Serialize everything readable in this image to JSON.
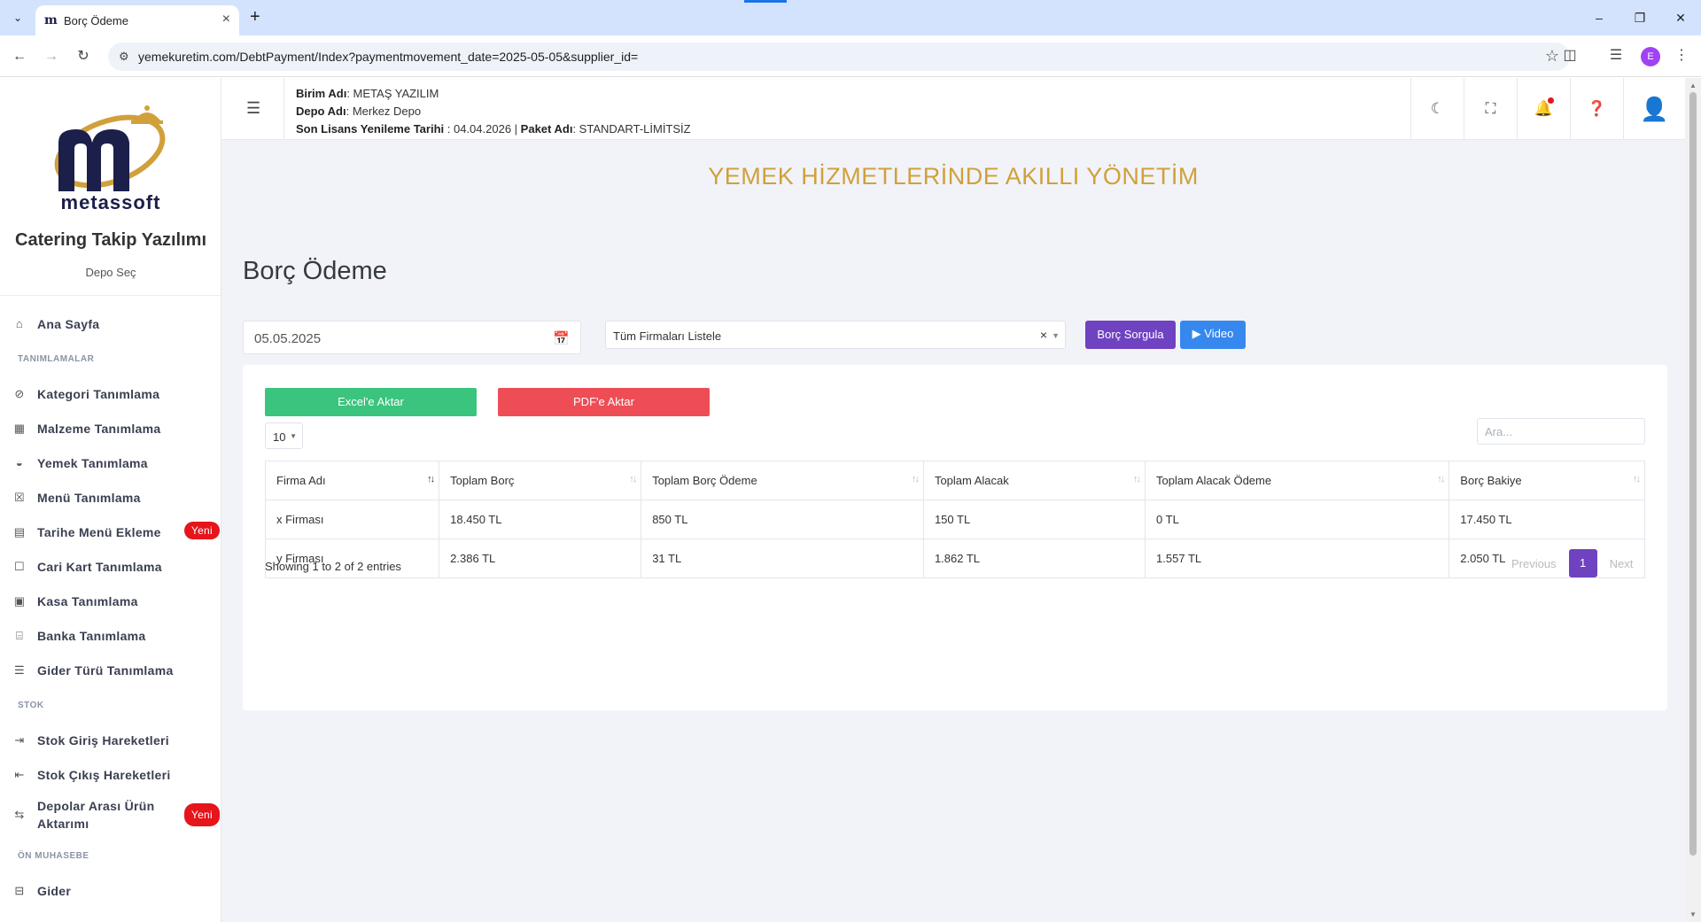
{
  "browser": {
    "tab_favicon": "m",
    "tab_title": "Borç Ödeme",
    "url": "yemekuretim.com/DebtPayment/Index?paymentmovement_date=2025-05-05&supplier_id=",
    "profile_initial": "E"
  },
  "sidebar": {
    "logo_text": "metassoft",
    "app_name": "Catering Takip Yazılımı",
    "depo_select": "Depo Seç",
    "items": [
      {
        "type": "item",
        "label": "Ana Sayfa",
        "icon": "home-icon"
      },
      {
        "type": "section",
        "label": "TANIMLAMALAR"
      },
      {
        "type": "item",
        "label": "Kategori Tanımlama",
        "icon": "tag-icon"
      },
      {
        "type": "item",
        "label": "Malzeme Tanımlama",
        "icon": "box-icon"
      },
      {
        "type": "item",
        "label": "Yemek Tanımlama",
        "icon": "bowl-icon"
      },
      {
        "type": "item",
        "label": "Menü Tanımlama",
        "icon": "menu-card-icon"
      },
      {
        "type": "item",
        "label": "Tarihe Menü Ekleme",
        "icon": "calendar-icon",
        "badge": "Yeni"
      },
      {
        "type": "item",
        "label": "Cari Kart Tanımlama",
        "icon": "contact-card-icon"
      },
      {
        "type": "item",
        "label": "Kasa Tanımlama",
        "icon": "cash-register-icon"
      },
      {
        "type": "item",
        "label": "Banka Tanımlama",
        "icon": "bank-icon"
      },
      {
        "type": "item",
        "label": "Gider Türü Tanımlama",
        "icon": "list-icon"
      },
      {
        "type": "section",
        "label": "STOK"
      },
      {
        "type": "item",
        "label": "Stok Giriş Hareketleri",
        "icon": "stock-in-icon"
      },
      {
        "type": "item",
        "label": "Stok Çıkış Hareketleri",
        "icon": "stock-out-icon"
      },
      {
        "type": "item",
        "label": "Depolar Arası Ürün Aktarımı",
        "icon": "transfer-icon",
        "badge": "Yeni",
        "tall": true
      },
      {
        "type": "section",
        "label": "ÖN MUHASEBE"
      },
      {
        "type": "item",
        "label": "Gider",
        "icon": "expense-icon"
      }
    ]
  },
  "header": {
    "unit_label": "Birim Adı",
    "unit_value": "METAŞ YAZILIM",
    "depot_label": "Depo Adı",
    "depot_value": "Merkez Depo",
    "license_label": "Son Lisans Yenileme Tarihi",
    "license_value": "04.04.2026",
    "package_label": "Paket Adı",
    "package_value": "STANDART-LİMİTSİZ"
  },
  "main": {
    "slogan": "YEMEK HİZMETLERİNDE AKILLI YÖNETİM",
    "page_title": "Borç Ödeme",
    "date_value": "05.05.2025",
    "supplier_select": "Tüm Firmaları Listele",
    "query_button": "Borç Sorgula",
    "video_button": "Video",
    "excel_button": "Excel'e Aktar",
    "pdf_button": "PDF'e Aktar",
    "page_length": "10",
    "search_placeholder": "Ara...",
    "columns": [
      "Firma Adı",
      "Toplam Borç",
      "Toplam Borç Ödeme",
      "Toplam Alacak",
      "Toplam Alacak Ödeme",
      "Borç Bakiye"
    ],
    "rows": [
      [
        "x Firması",
        "18.450 TL",
        "850 TL",
        "150 TL",
        "0 TL",
        "17.450 TL"
      ],
      [
        "y Firması",
        "2.386 TL",
        "31 TL",
        "1.862 TL",
        "1.557 TL",
        "2.050 TL"
      ]
    ],
    "info": "Showing 1 to 2 of 2 entries",
    "pagination": {
      "previous": "Previous",
      "current": "1",
      "next": "Next"
    }
  }
}
